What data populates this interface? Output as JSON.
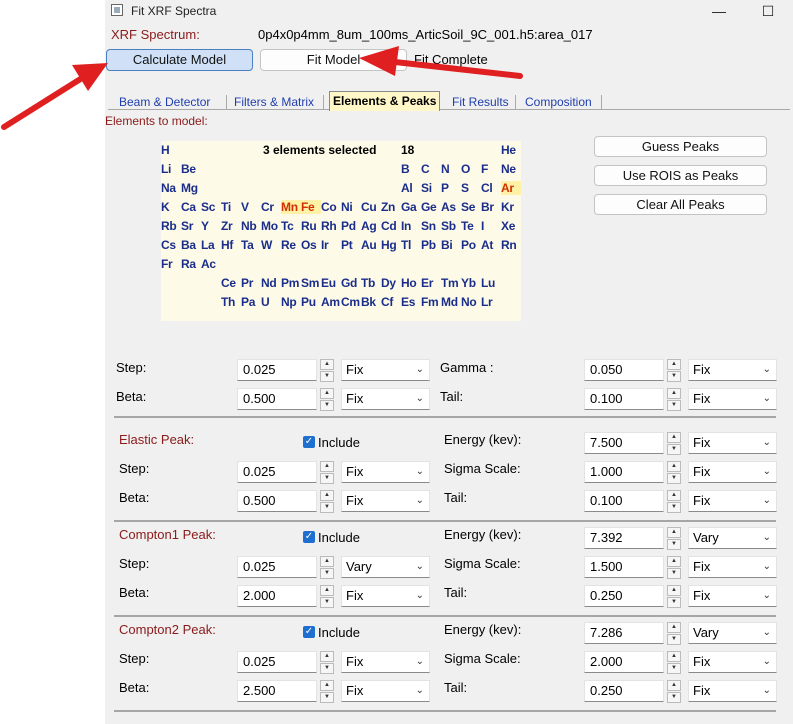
{
  "window": {
    "title": "Fit XRF Spectra",
    "minimize": "—",
    "maximize": "☐"
  },
  "header": {
    "spectrum_label": "XRF Spectrum:",
    "spectrum_value": "0p4x0p4mm_8um_100ms_ArticSoil_9C_001.h5:area_017"
  },
  "toolbar": {
    "calculate": "Calculate Model",
    "fit": "Fit Model",
    "status": "Fit Complete"
  },
  "tabs": [
    "Beam & Detector",
    "Filters & Matrix",
    "Elements & Peaks",
    "Fit Results",
    "Composition"
  ],
  "section_label": "Elements to model:",
  "periodic": {
    "selected_text": "3 elements selected",
    "count": "18",
    "rows": [
      [
        "H",
        "",
        "",
        "",
        "",
        "",
        "",
        "",
        "",
        "",
        "",
        "",
        "",
        "",
        "",
        "",
        "",
        "He"
      ],
      [
        "Li",
        "Be",
        "",
        "",
        "",
        "",
        "",
        "",
        "",
        "",
        "",
        "",
        "B",
        "C",
        "N",
        "O",
        "F",
        "Ne"
      ],
      [
        "Na",
        "Mg",
        "",
        "",
        "",
        "",
        "",
        "",
        "",
        "",
        "",
        "",
        "Al",
        "Si",
        "P",
        "S",
        "Cl",
        "Ar"
      ],
      [
        "K",
        "Ca",
        "Sc",
        "Ti",
        "V",
        "Cr",
        "Mn",
        "Fe",
        "Co",
        "Ni",
        "Cu",
        "Zn",
        "Ga",
        "Ge",
        "As",
        "Se",
        "Br",
        "Kr"
      ],
      [
        "Rb",
        "Sr",
        "Y",
        "Zr",
        "Nb",
        "Mo",
        "Tc",
        "Ru",
        "Rh",
        "Pd",
        "Ag",
        "Cd",
        "In",
        "Sn",
        "Sb",
        "Te",
        "I",
        "Xe"
      ],
      [
        "Cs",
        "Ba",
        "La",
        "Hf",
        "Ta",
        "W",
        "Re",
        "Os",
        "Ir",
        "Pt",
        "Au",
        "Hg",
        "Tl",
        "Pb",
        "Bi",
        "Po",
        "At",
        "Rn"
      ],
      [
        "Fr",
        "Ra",
        "Ac",
        "",
        "",
        "",
        "",
        "",
        "",
        "",
        "",
        "",
        "",
        "",
        "",
        "",
        "",
        ""
      ],
      [
        "",
        "",
        "",
        "Ce",
        "Pr",
        "Nd",
        "Pm",
        "Sm",
        "Eu",
        "Gd",
        "Tb",
        "Dy",
        "Ho",
        "Er",
        "Tm",
        "Yb",
        "Lu",
        ""
      ],
      [
        "",
        "",
        "",
        "Th",
        "Pa",
        "U",
        "Np",
        "Pu",
        "Am",
        "Cm",
        "Bk",
        "Cf",
        "Es",
        "Fm",
        "Md",
        "No",
        "Lr",
        ""
      ]
    ],
    "selected": [
      "Mn",
      "Fe",
      "Ar"
    ]
  },
  "side_buttons": {
    "guess": "Guess Peaks",
    "rois": "Use ROIS as Peaks",
    "clear": "Clear All Peaks"
  },
  "params": {
    "step_label": "Step:",
    "step_value": "0.025",
    "step_mode": "Fix",
    "beta_label": "Beta:",
    "beta_value": "0.500",
    "beta_mode": "Fix",
    "gamma_label": "Gamma :",
    "gamma_value": "0.050",
    "gamma_mode": "Fix",
    "tail_label": "Tail:",
    "tail_value": "0.100",
    "tail_mode": "Fix"
  },
  "peaks": [
    {
      "name": "Elastic Peak:",
      "include": "Include",
      "energy_label": "Energy (kev):",
      "energy": "7.500",
      "energy_mode": "Fix",
      "step": "0.025",
      "step_mode": "Fix",
      "sigma_label": "Sigma Scale:",
      "sigma": "1.000",
      "sigma_mode": "Fix",
      "beta": "0.500",
      "beta_mode": "Fix",
      "tail": "0.100",
      "tail_mode": "Fix"
    },
    {
      "name": "Compton1 Peak:",
      "include": "Include",
      "energy_label": "Energy (kev):",
      "energy": "7.392",
      "energy_mode": "Vary",
      "step": "0.025",
      "step_mode": "Vary",
      "sigma_label": "Sigma Scale:",
      "sigma": "1.500",
      "sigma_mode": "Fix",
      "beta": "2.000",
      "beta_mode": "Fix",
      "tail": "0.250",
      "tail_mode": "Fix"
    },
    {
      "name": "Compton2 Peak:",
      "include": "Include",
      "energy_label": "Energy (kev):",
      "energy": "7.286",
      "energy_mode": "Vary",
      "step": "0.025",
      "step_mode": "Fix",
      "sigma_label": "Sigma Scale:",
      "sigma": "2.000",
      "sigma_mode": "Fix",
      "beta": "2.500",
      "beta_mode": "Fix",
      "tail": "0.250",
      "tail_mode": "Fix"
    }
  ],
  "labels": {
    "step": "Step:",
    "beta": "Beta:",
    "tail": "Tail:"
  },
  "colors": {
    "annotation_arrow": "#e02020",
    "active_tab": "#fff7c8",
    "primary_button": "#cfe0f7"
  }
}
